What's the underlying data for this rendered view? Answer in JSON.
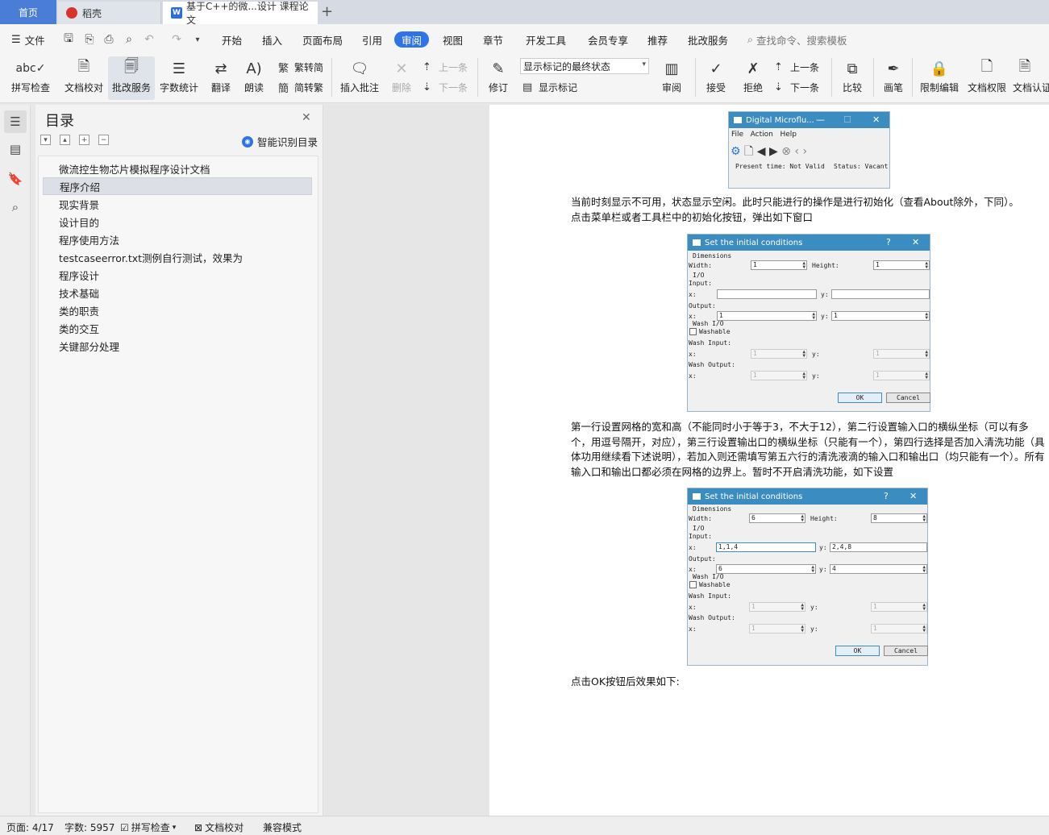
{
  "tabs": {
    "home": "首页",
    "daoke": "稻壳",
    "document": "基于C++的微...设计 课程论文",
    "new_tab": "+"
  },
  "menu": {
    "file": "文件",
    "items": [
      "开始",
      "插入",
      "页面布局",
      "引用",
      "审阅",
      "视图",
      "章节",
      "开发工具",
      "会员专享",
      "推荐",
      "批改服务"
    ],
    "active": "审阅",
    "search": "查找命令、搜索模板"
  },
  "ribbon": {
    "spell_check": "拼写检查",
    "doc_proof": "文档校对",
    "review_service": "批改服务",
    "word_count": "字数统计",
    "translate": "翻译",
    "read_aloud": "朗读",
    "trad_to_simp": "繁转简",
    "simp_to_trad": "简转繁",
    "insert_comment": "插入批注",
    "delete": "删除",
    "prev_comment": "上一条",
    "next_comment": "下一条",
    "track_changes": "修订",
    "markup_state": "显示标记的最终状态",
    "show_markup": "显示标记",
    "review_pane": "审阅",
    "accept": "接受",
    "reject": "拒绝",
    "prev_change": "上一条",
    "next_change": "下一条",
    "compare": "比较",
    "ink": "画笔",
    "restrict_edit": "限制编辑",
    "doc_rights": "文档权限",
    "doc_cert": "文档认证"
  },
  "outline": {
    "title": "目录",
    "smart_toc": "智能识别目录",
    "items": [
      "微流控生物芯片模拟程序设计文档",
      "程序介绍",
      "现实背景",
      "设计目的",
      "程序使用方法",
      "testcaseerror.txt测例自行测试，效果为",
      "程序设计",
      "技术基础",
      "类的职责",
      "类的交互",
      "关键部分处理"
    ],
    "selected_index": 1
  },
  "document": {
    "main_window": {
      "title": "Digital Microflu...",
      "menu": [
        "File",
        "Action",
        "Help"
      ],
      "present_time": "Present time: Not Valid",
      "status": "Status: Vacant"
    },
    "para1": "当前时刻显示不可用，状态显示空闲。此时只能进行的操作是进行初始化（查看About除外，下同）。",
    "para2": "点击菜单栏或者工具栏中的初始化按钮，弹出如下窗口",
    "dialog": {
      "title": "Set the initial conditions",
      "help": "?",
      "dimensions": "Dimensions",
      "width": "Width:",
      "height": "Height:",
      "io": "I/O",
      "input": "Input:",
      "output": "Output:",
      "x": "x:",
      "y": "y:",
      "wash_io": "Wash I/O",
      "washable": "Washable",
      "wash_input": "Wash Input:",
      "wash_output": "Wash Output:",
      "ok": "OK",
      "cancel": "Cancel"
    },
    "dialog1_values": {
      "width": "1",
      "height": "1",
      "input_x": "",
      "input_y": "",
      "output_x": "1",
      "output_y": "1",
      "wash_in_x": "1",
      "wash_in_y": "1",
      "wash_out_x": "1",
      "wash_out_y": "1"
    },
    "para3": "第一行设置网格的宽和高（不能同时小于等于3，不大于12），第二行设置输入口的横纵坐标（可以有多个，用逗号隔开，对应），第三行设置输出口的横纵坐标（只能有一个），第四行选择是否加入清洗功能（具体功用继续看下述说明），若加入则还需填写第五六行的清洗液滴的输入口和输出口（均只能有一个）。所有输入口和输出口都必须在网格的边界上。暂时不开启清洗功能，如下设置",
    "dialog2_values": {
      "width": "6",
      "height": "8",
      "input_x": "1,1,4",
      "input_y": "2,4,8",
      "output_x": "6",
      "output_y": "4",
      "wash_in_x": "1",
      "wash_in_y": "1",
      "wash_out_x": "1",
      "wash_out_y": "1"
    },
    "para4": "点击OK按钮后效果如下:"
  },
  "status": {
    "page": "页面: 4/17",
    "words": "字数: 5957",
    "spell": "拼写检查",
    "proof": "文档校对",
    "compat": "兼容模式"
  },
  "colors": {
    "accent": "#2f73e8",
    "dialog_title": "#3b8cc1",
    "home_tab": "#4a7dd8"
  }
}
